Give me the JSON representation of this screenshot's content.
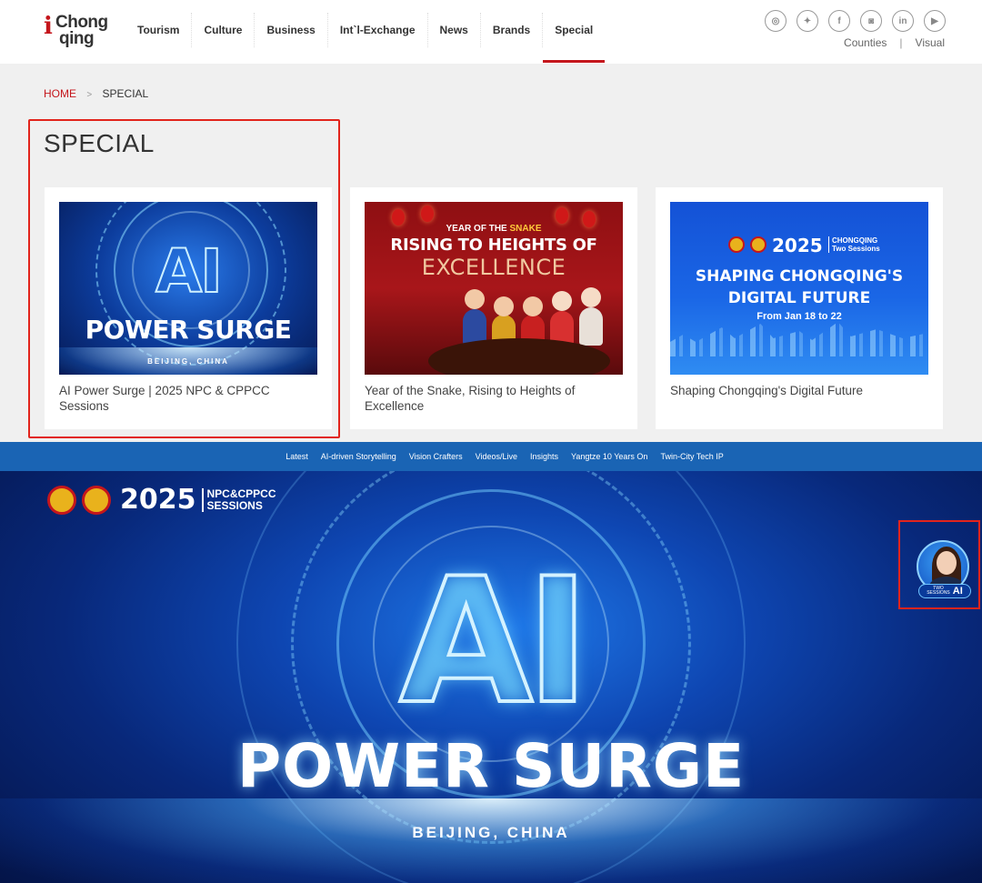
{
  "logo": {
    "mark": "i",
    "line1": "Chong",
    "line2": "qing"
  },
  "nav": {
    "items": [
      "Tourism",
      "Culture",
      "Business",
      "Int`l-Exchange",
      "News",
      "Brands",
      "Special"
    ],
    "active": "Special"
  },
  "social": {
    "icons": [
      "wechat-icon",
      "twitter-icon",
      "facebook-icon",
      "instagram-icon",
      "linkedin-icon",
      "youtube-icon"
    ],
    "glyphs": [
      "◎",
      "✦",
      "f",
      "◙",
      "in",
      "▶"
    ]
  },
  "sublinks": {
    "counties": "Counties",
    "sep": "|",
    "visual": "Visual"
  },
  "breadcrumb": {
    "home": "HOME",
    "arrow": ">",
    "current": "SPECIAL"
  },
  "page_title": "SPECIAL",
  "cards": [
    {
      "title": "AI Power Surge | 2025 NPC & CPPCC Sessions",
      "thumb": {
        "ai": "AI",
        "headline": "POWER SURGE",
        "location": "BEIJING, CHINA"
      }
    },
    {
      "title": "Year of the Snake, Rising to Heights of Excellence",
      "thumb": {
        "kicker_a": "YEAR OF THE",
        "kicker_b": "SNAKE",
        "line1": "RISING TO HEIGHTS OF",
        "line2": "EXCELLENCE"
      }
    },
    {
      "title": "Shaping Chongqing's Digital Future",
      "thumb": {
        "year": "2025",
        "tag1": "CHONGQING",
        "tag2": "Two Sessions",
        "line1": "SHAPING CHONGQING'S",
        "line2": "DIGITAL FUTURE",
        "dates": "From Jan 18 to 22"
      }
    }
  ],
  "subnav": {
    "items": [
      "Latest",
      "AI-driven Storytelling",
      "Vision Crafters",
      "Videos/Live",
      "Insights",
      "Yangtze 10 Years On",
      "Twin-City Tech IP"
    ]
  },
  "hero": {
    "badge_year": "2025",
    "badge_line1": "NPC&CPPCC",
    "badge_line2": "SESSIONS",
    "ai": "AI",
    "headline": "POWER SURGE",
    "location": "BEIJING, CHINA"
  },
  "assistant": {
    "line1": "TWO",
    "line2": "SESSIONS",
    "ai": "AI"
  },
  "colors": {
    "brand_red": "#c4161c",
    "subnav_blue": "#1a64b4",
    "highlight": "#e2241c"
  }
}
